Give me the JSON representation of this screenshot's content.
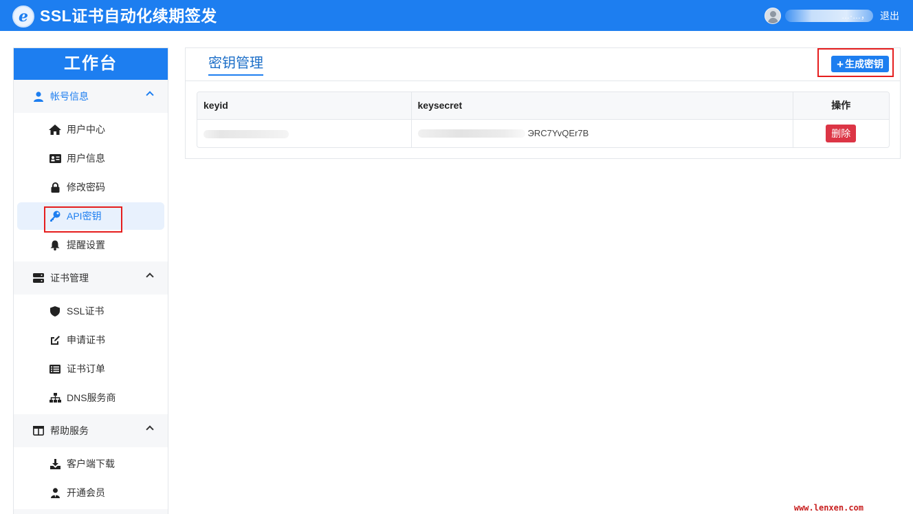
{
  "app": {
    "title": "SSL证书自动化续期签发",
    "logo_letter": "e"
  },
  "user": {
    "name_suffix": "…·…，",
    "logout_label": "退出"
  },
  "sidebar": {
    "header": "工作台",
    "groups": [
      {
        "label": "帐号信息",
        "icon": "user-icon",
        "items": [
          {
            "label": "用户中心",
            "icon": "home-icon"
          },
          {
            "label": "用户信息",
            "icon": "id-card-icon"
          },
          {
            "label": "修改密码",
            "icon": "lock-icon"
          },
          {
            "label": "API密钥",
            "icon": "key-icon",
            "active": true
          },
          {
            "label": "提醒设置",
            "icon": "bell-icon"
          }
        ]
      },
      {
        "label": "证书管理",
        "icon": "server-icon",
        "items": [
          {
            "label": "SSL证书",
            "icon": "shield-icon"
          },
          {
            "label": "申请证书",
            "icon": "edit-icon"
          },
          {
            "label": "证书订单",
            "icon": "list-icon"
          },
          {
            "label": "DNS服务商",
            "icon": "sitemap-icon"
          }
        ]
      },
      {
        "label": "帮助服务",
        "icon": "columns-icon",
        "items": [
          {
            "label": "客户端下载",
            "icon": "download-icon"
          },
          {
            "label": "开通会员",
            "icon": "user-tie-icon"
          }
        ]
      }
    ]
  },
  "main": {
    "tab_label": "密钥管理",
    "generate_button": "生成密钥",
    "generate_plus": "+",
    "table": {
      "columns": [
        "keyid",
        "keysecret",
        "操作"
      ],
      "rows": [
        {
          "keysecret_tail": "ЭRC7YvQEr7B",
          "action": "删除"
        }
      ]
    }
  },
  "watermark": "www.lenxen.com",
  "colors": {
    "primary": "#1d7ef0",
    "danger": "#dc3545",
    "highlight": "#e51c1c"
  }
}
